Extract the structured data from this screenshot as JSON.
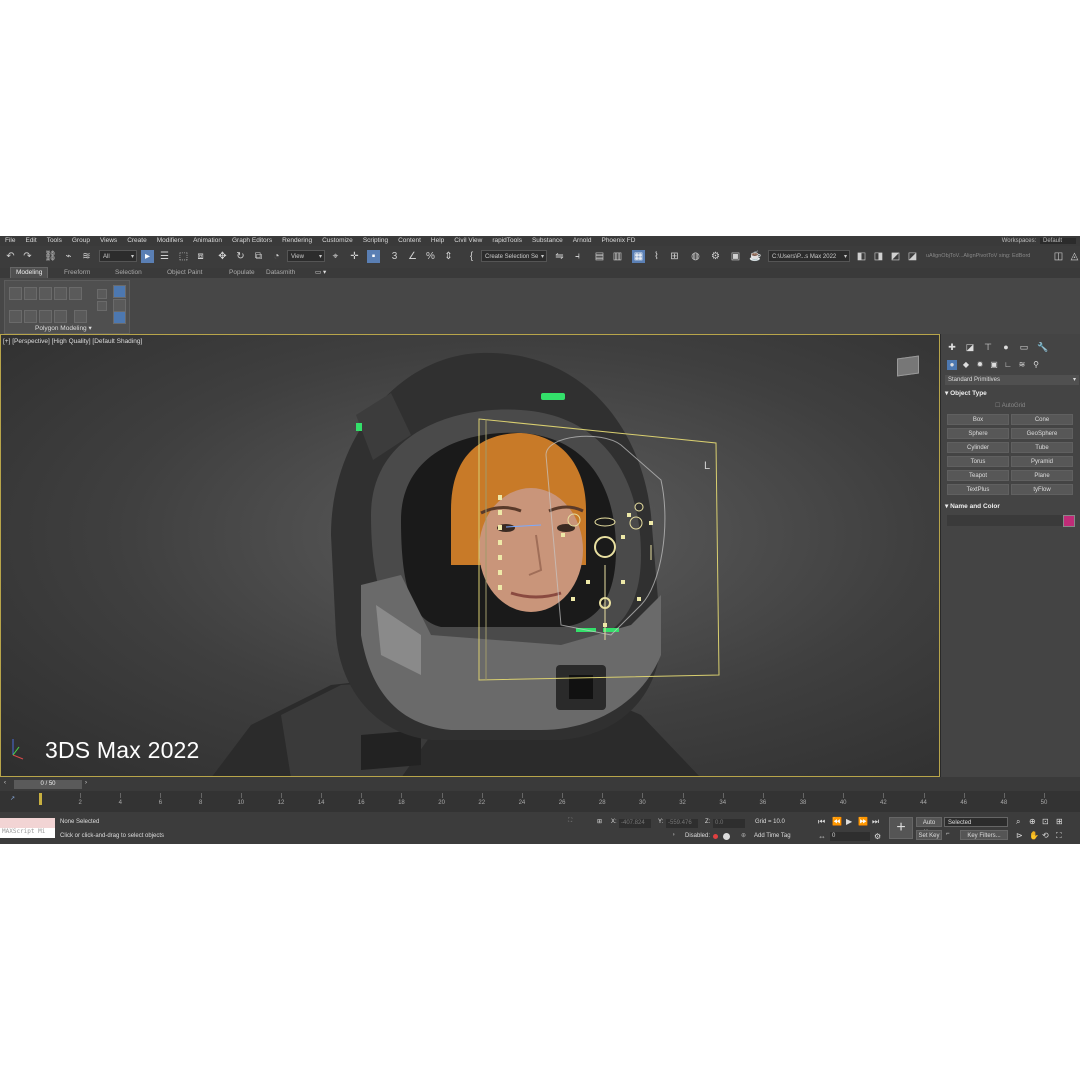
{
  "menu": {
    "items": [
      "File",
      "Edit",
      "Tools",
      "Group",
      "Views",
      "Create",
      "Modifiers",
      "Animation",
      "Graph Editors",
      "Rendering",
      "Customize",
      "Scripting",
      "Content",
      "Help",
      "Civil View",
      "rapidTools",
      "Substance",
      "Arnold",
      "Phoenix FD"
    ],
    "workspace_label": "Workspaces:",
    "workspace_value": "Default"
  },
  "toolbar": {
    "filter_dropdown": "All",
    "refcoord_dropdown": "View",
    "selection_set_dropdown": "Create Selection Se",
    "path_dropdown": "C:\\Users\\P...s Max 2022",
    "script_text": "uAlignObjToV...AlignPivotToV sing: EdBord"
  },
  "ribbon": {
    "tabs": [
      "Modeling",
      "Freeform",
      "Selection",
      "Object Paint",
      "Populate",
      "Datasmith"
    ],
    "active_tab": "Modeling",
    "panel_label": "Polygon Modeling"
  },
  "viewport": {
    "label": "[+] [Perspective] [High Quality] [Default Shading]",
    "watermark": "3DS Max 2022",
    "rig_marker": "L"
  },
  "command_panel": {
    "category_dropdown": "Standard Primitives",
    "object_type_title": "Object Type",
    "autogrid_label": "AutoGrid",
    "primitives": [
      "Box",
      "Cone",
      "Sphere",
      "GeoSphere",
      "Cylinder",
      "Tube",
      "Torus",
      "Pyramid",
      "Teapot",
      "Plane",
      "TextPlus",
      "tyFlow"
    ],
    "name_color_title": "Name and Color",
    "object_color": "#c02c78"
  },
  "timeline": {
    "slider_label": "0 / 50",
    "ticks": [
      "2",
      "4",
      "6",
      "8",
      "10",
      "12",
      "14",
      "16",
      "18",
      "20",
      "22",
      "24",
      "26",
      "28",
      "30",
      "32",
      "34",
      "36",
      "38",
      "40",
      "42",
      "44",
      "46",
      "48",
      "50"
    ]
  },
  "status": {
    "maxscript_placeholder": "MAXScript Mi",
    "selection": "None Selected",
    "prompt": "Click or click-and-drag to select objects",
    "x_label": "X:",
    "x_value": "-407.824",
    "y_label": "Y:",
    "y_value": "-559.476",
    "z_label": "Z:",
    "z_value": "0.0",
    "grid": "Grid = 10.0",
    "disabled": "Disabled:",
    "add_time_tag": "Add Time Tag",
    "auto_key": "Auto Key",
    "selected_dropdown": "Selected",
    "set_key": "Set Key",
    "key_filters": "Key Filters...",
    "frame_value": "0"
  }
}
